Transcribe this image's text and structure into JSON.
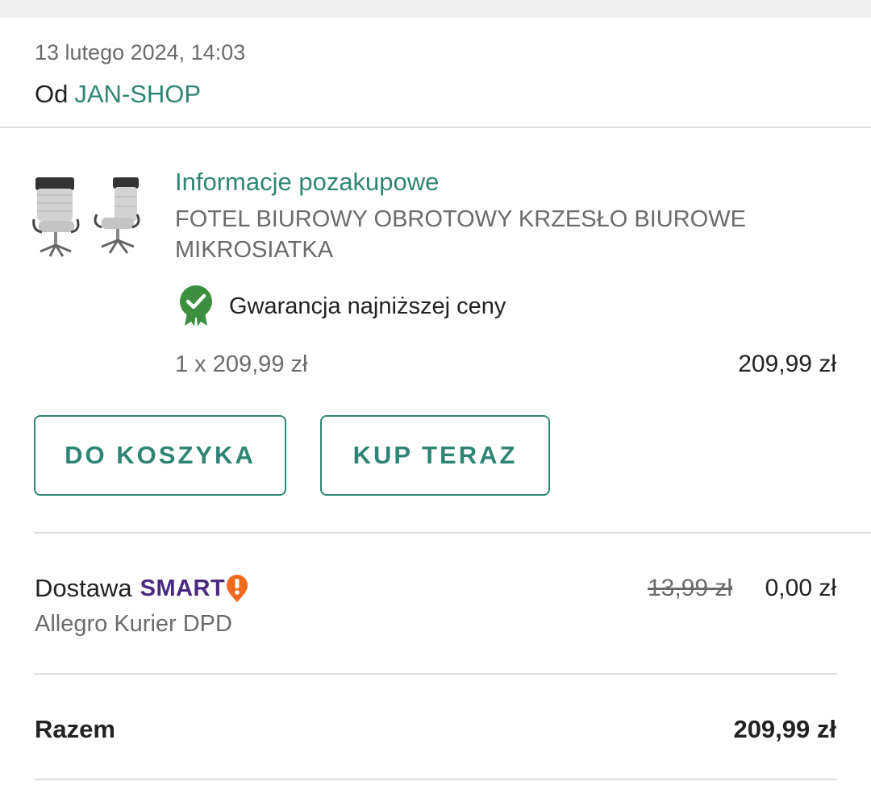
{
  "order": {
    "date": "13 lutego 2024, 14:03",
    "from_label": "Od",
    "seller": "JAN-SHOP"
  },
  "product": {
    "section_title": "Informacje pozakupowe",
    "name": "FOTEL BIUROWY OBROTOWY KRZESŁO BIUROWE MIKROSIATKA",
    "thumbnail_icon": "office-chair-image",
    "guarantee_icon": "badge-check-icon",
    "guarantee_label": "Gwarancja najniższej ceny",
    "quantity_price": "1 x 209,99 zł",
    "line_total": "209,99 zł"
  },
  "actions": {
    "add_to_cart": "DO KOSZYKA",
    "buy_now": "KUP TERAZ"
  },
  "delivery": {
    "label": "Dostawa",
    "smart_text": "SMART",
    "smart_icon": "smart-exclamation-icon",
    "old_price": "13,99 zł",
    "price": "0,00 zł",
    "carrier": "Allegro Kurier DPD"
  },
  "summary": {
    "total_label": "Razem",
    "total_value": "209,99 zł"
  },
  "colors": {
    "accent": "#2f8574",
    "badge_green": "#3b8f3e",
    "smart_purple": "#4a2a7e",
    "smart_orange": "#f06a1d"
  }
}
